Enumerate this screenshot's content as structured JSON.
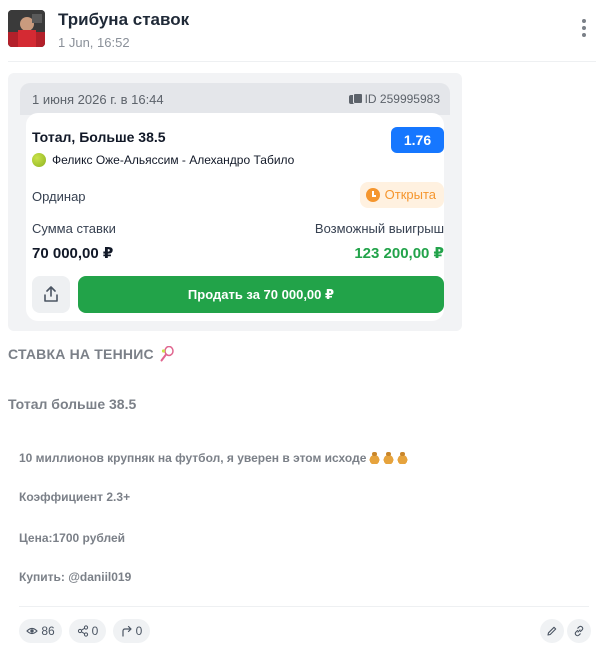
{
  "header": {
    "channel_title": "Трибуна ставок",
    "date": "1 Jun, 16:52"
  },
  "bet": {
    "datetime": "1 июня 2026 г. в 16:44",
    "id_label": "ID 259995983",
    "market": "Тотал, Больше 38.5",
    "odds": "1.76",
    "match": "Феликс Оже-Альяссим - Алехандро Табило",
    "type": "Ординар",
    "status": "Открыта",
    "stake_label": "Сумма ставки",
    "stake_value": "70 000,00 ₽",
    "win_label": "Возможный выигрыш",
    "win_value": "123 200,00 ₽",
    "sell_label": "Продать за 70 000,00 ₽",
    "colors": {
      "odds": "#1677ff",
      "status": "#f5962e",
      "win": "#22a34a",
      "sell": "#22a349"
    }
  },
  "post": {
    "headline": "СТАВКА НА ТЕННИС",
    "subheadline": "Тотал больше 38.5",
    "line1": "10 миллионов крупняк на футбол, я уверен в этом исходе",
    "line2": "Коэффициент 2.3+",
    "line3": "Цена:1700 рублей",
    "line4": "Купить: @daniil019"
  },
  "footer": {
    "views": "86",
    "reposts": "0",
    "shares": "0"
  },
  "icons": [
    "more-icon",
    "copy-icon",
    "tennis-ball-icon",
    "clock-icon",
    "share-icon",
    "tennis-racket-icon",
    "money-bag-icon",
    "eye-icon",
    "repost-icon",
    "forward-icon",
    "pencil-icon",
    "link-icon"
  ]
}
